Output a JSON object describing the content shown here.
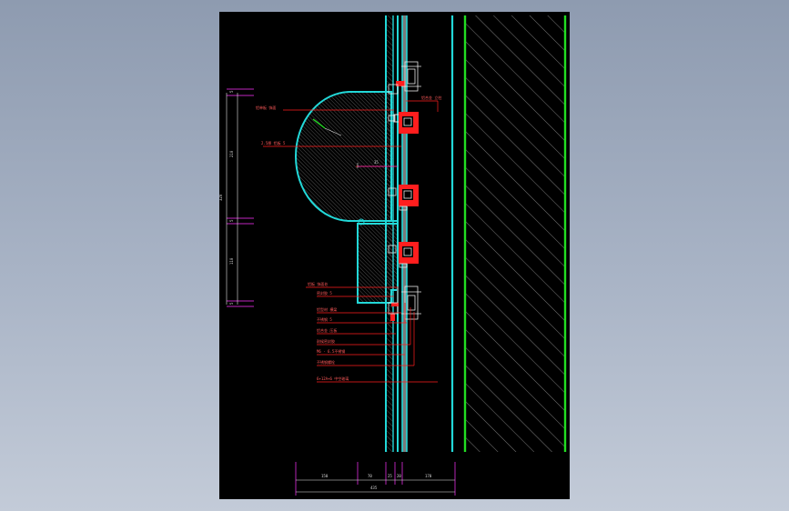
{
  "viewer": {
    "background_top": "#8e9bb0",
    "background_bottom": "#c3cbd8",
    "sheet_color": "#000000"
  },
  "drawing": {
    "colors": {
      "cyan": "#22d8d8",
      "green": "#22dd22",
      "red": "#ff1e1e",
      "white": "#e6e6e6",
      "magenta": "#ff33ff",
      "hatch": "#9a9a9a"
    },
    "left_dims": {
      "total": "320",
      "top": "210",
      "bottom": "110",
      "small_top": "5",
      "small_mid": "5",
      "small_bot": "5"
    },
    "callouts": {
      "top_right_1": "铝合金 立柱",
      "top_left_1": "铝单板 饰面",
      "top_left_2": "2.5厚 铝板 5",
      "mid_dim": "35",
      "bottom": [
        "铝板 饰面处",
        "密封胶 5",
        "铝型材 横梁",
        "不锈钢 5",
        "铝合金 压板",
        "耐候密封胶",
        "M6 · 6.5不锈钢",
        "不锈钢螺栓",
        "6+12A+6 中空玻璃"
      ]
    },
    "bottom_dims": {
      "d1": "150",
      "d2": "70",
      "d3": "25",
      "d4": "20",
      "d5": "170",
      "total": "435"
    }
  }
}
